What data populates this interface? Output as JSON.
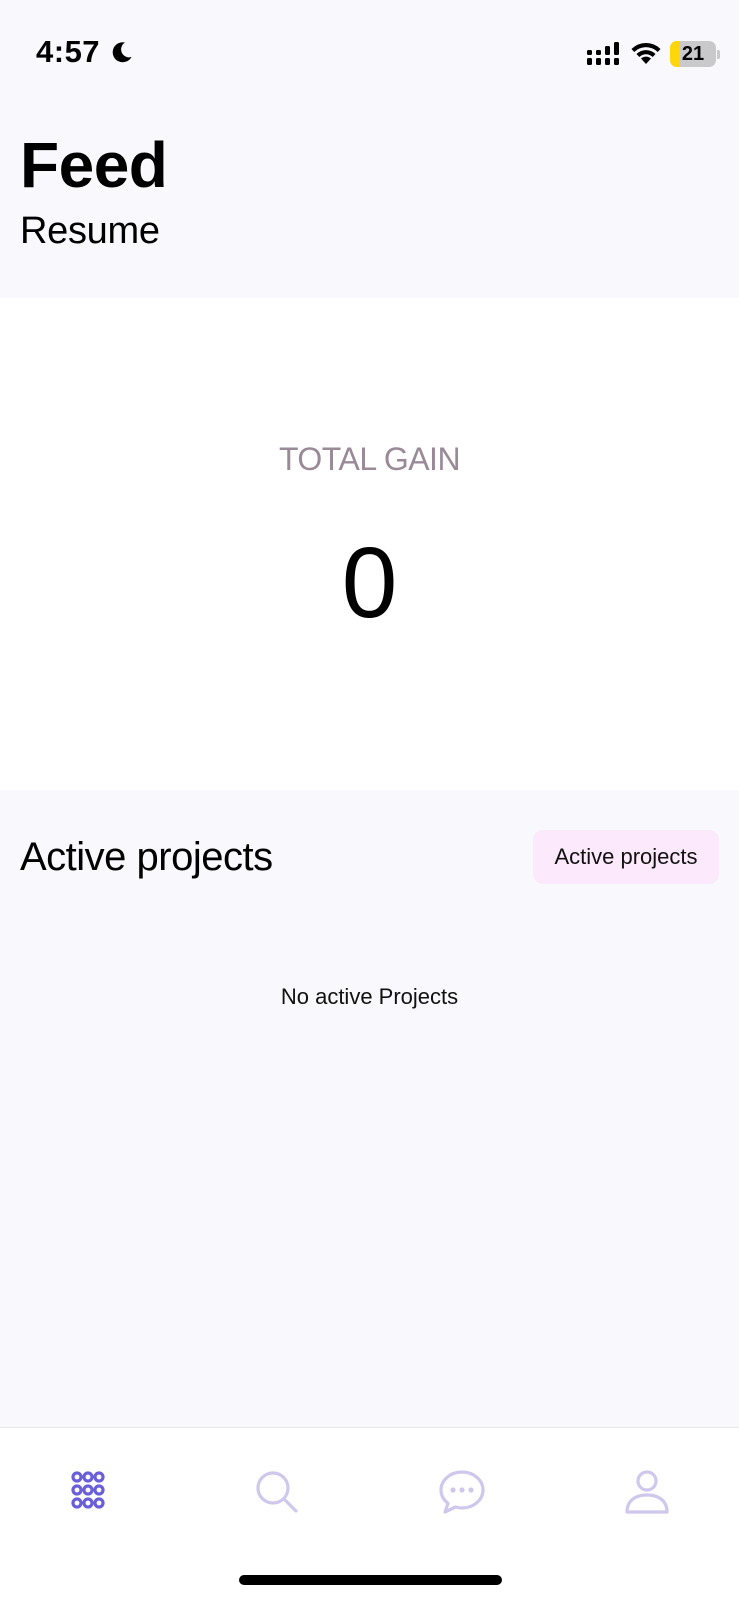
{
  "status_bar": {
    "time": "4:57",
    "battery_level": "21",
    "battery_fraction": 0.21,
    "icons": [
      "moon-icon",
      "signal-icon",
      "wifi-icon",
      "battery-icon"
    ]
  },
  "header": {
    "title": "Feed",
    "subtitle": "Resume"
  },
  "gain": {
    "label": "TOTAL GAIN",
    "value": "0"
  },
  "projects": {
    "title": "Active projects",
    "chip_label": "Active projects",
    "empty_message": "No active Projects"
  },
  "nav": {
    "items": [
      {
        "icon": "grid-icon",
        "active": true
      },
      {
        "icon": "search-icon",
        "active": false
      },
      {
        "icon": "chat-icon",
        "active": false
      },
      {
        "icon": "profile-icon",
        "active": false
      }
    ],
    "active_color": "#6b5fd9",
    "inactive_color": "#cfc8ec"
  },
  "colors": {
    "background": "#f8f8fd",
    "card": "#ffffff",
    "gain_label": "#9a8a98",
    "chip_background": "#fce9fb",
    "battery": "#ffd60a"
  }
}
